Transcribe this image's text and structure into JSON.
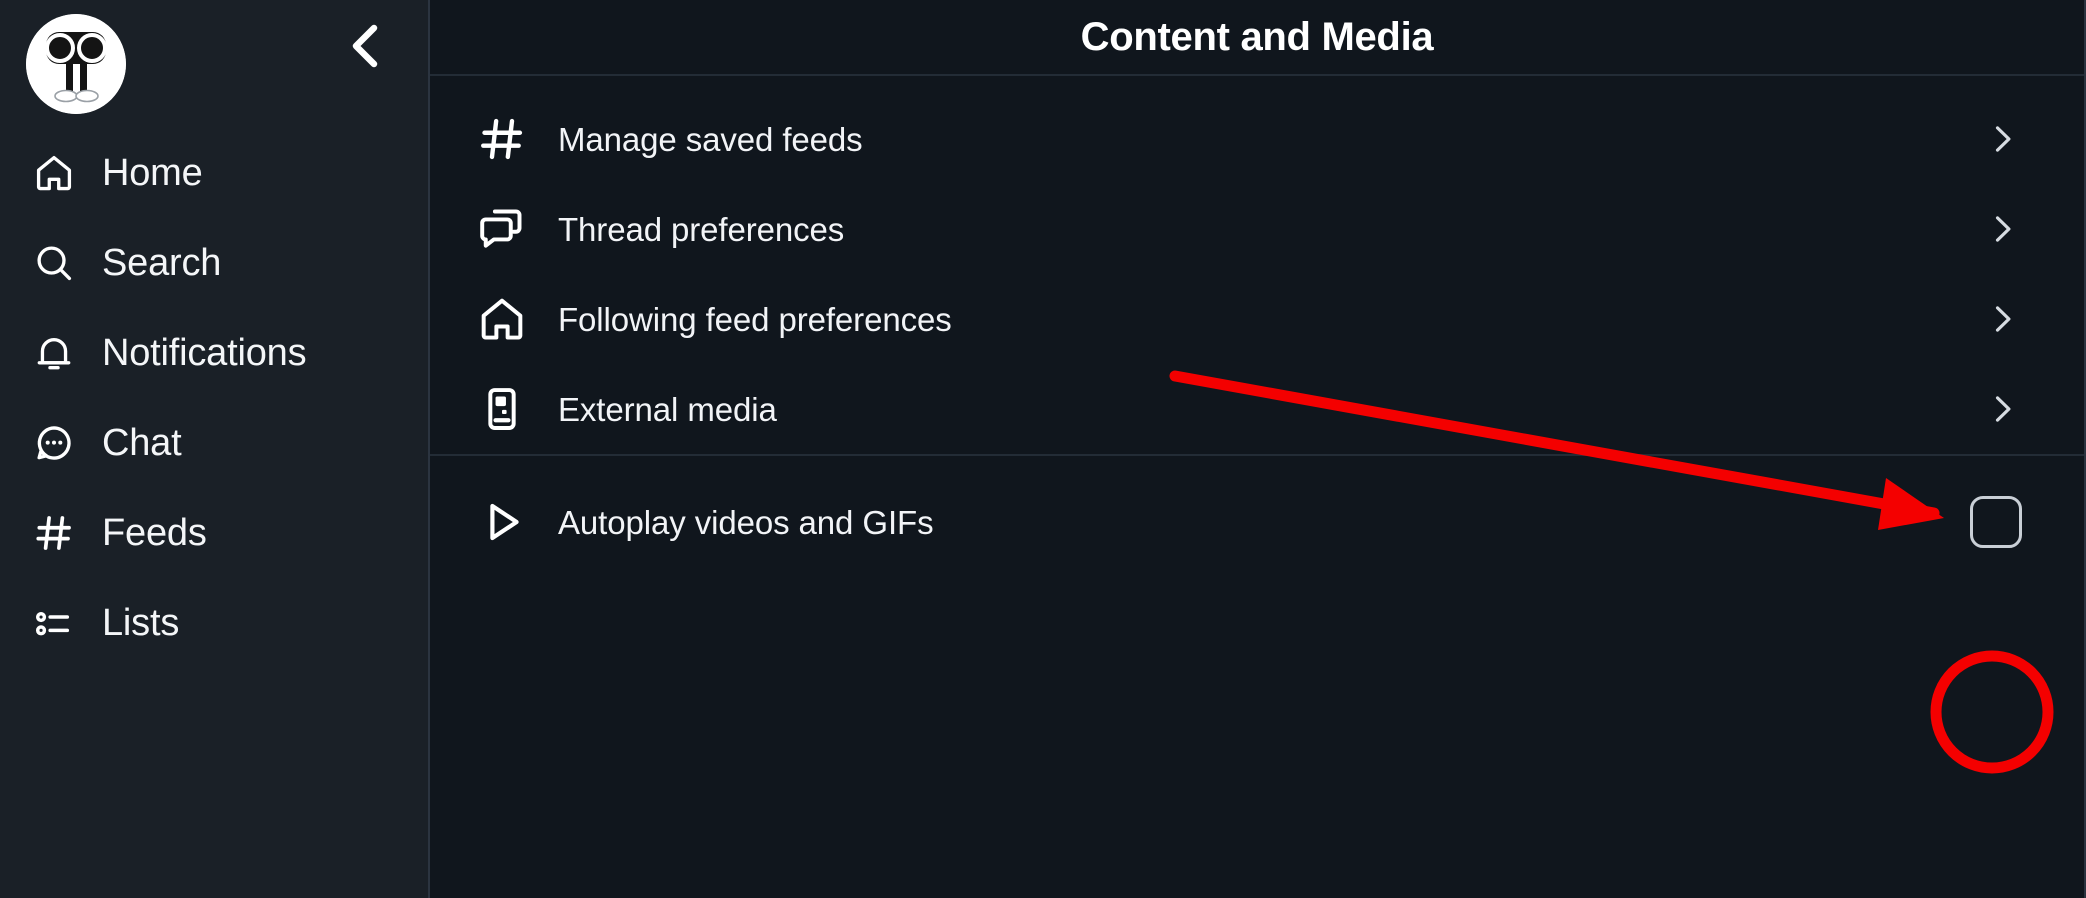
{
  "theme": {
    "app_background": "#10161d",
    "sidebar_background": "#1a2027",
    "divider": "#2b3440",
    "text_primary": "#f2f4f7",
    "annotation_red": "#f40000"
  },
  "sidebar": {
    "avatar_name": "user-avatar",
    "collapse_label": "chevron-left-icon",
    "items": [
      {
        "label": "Home",
        "icon": "home-icon"
      },
      {
        "label": "Search",
        "icon": "search-icon"
      },
      {
        "label": "Notifications",
        "icon": "bell-icon"
      },
      {
        "label": "Chat",
        "icon": "chat-bubble-icon"
      },
      {
        "label": "Feeds",
        "icon": "hash-icon"
      },
      {
        "label": "Lists",
        "icon": "list-icon"
      }
    ]
  },
  "header": {
    "title": "Content and Media"
  },
  "settings": {
    "group_1": [
      {
        "label": "Manage saved feeds",
        "icon": "hash-icon",
        "control": "chevron"
      },
      {
        "label": "Thread preferences",
        "icon": "threads-icon",
        "control": "chevron"
      },
      {
        "label": "Following feed preferences",
        "icon": "home-icon",
        "control": "chevron"
      },
      {
        "label": "External media",
        "icon": "media-player-icon",
        "control": "chevron"
      }
    ],
    "group_2": [
      {
        "label": "Autoplay videos and GIFs",
        "icon": "play-icon",
        "control": "checkbox",
        "checked": false
      }
    ]
  },
  "annotation": {
    "type": "arrow-and-circle",
    "target": "autoplay-videos-checkbox",
    "color": "#f40000"
  }
}
